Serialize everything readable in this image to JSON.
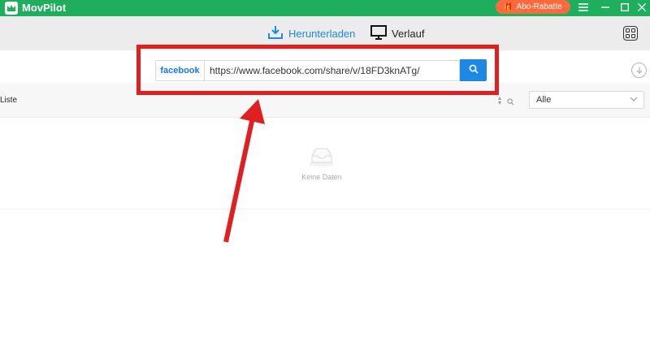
{
  "app": {
    "title": "MovPilot",
    "promo_label": "Abo-Rabatte",
    "colors": {
      "titlebar": "#1fae5e",
      "accent": "#1e88e5",
      "promo": "#ff6a3d",
      "highlight": "#e02020"
    }
  },
  "window_controls": {
    "menu_icon": "hamburger-icon",
    "minimize_icon": "minimize-icon",
    "maximize_icon": "maximize-icon",
    "close_icon": "close-icon"
  },
  "tabs": [
    {
      "label": "Herunterladen",
      "icon": "download-tray-icon",
      "active": true
    },
    {
      "label": "Verlauf",
      "icon": "monitor-icon",
      "active": false
    }
  ],
  "search": {
    "platform": "facebook",
    "url_value": "https://www.facebook.com/share/v/18FD3knATg/",
    "button_icon": "search-icon"
  },
  "list": {
    "label": "Liste",
    "filter_value": "Alle",
    "empty_text": "Keine Daten"
  }
}
